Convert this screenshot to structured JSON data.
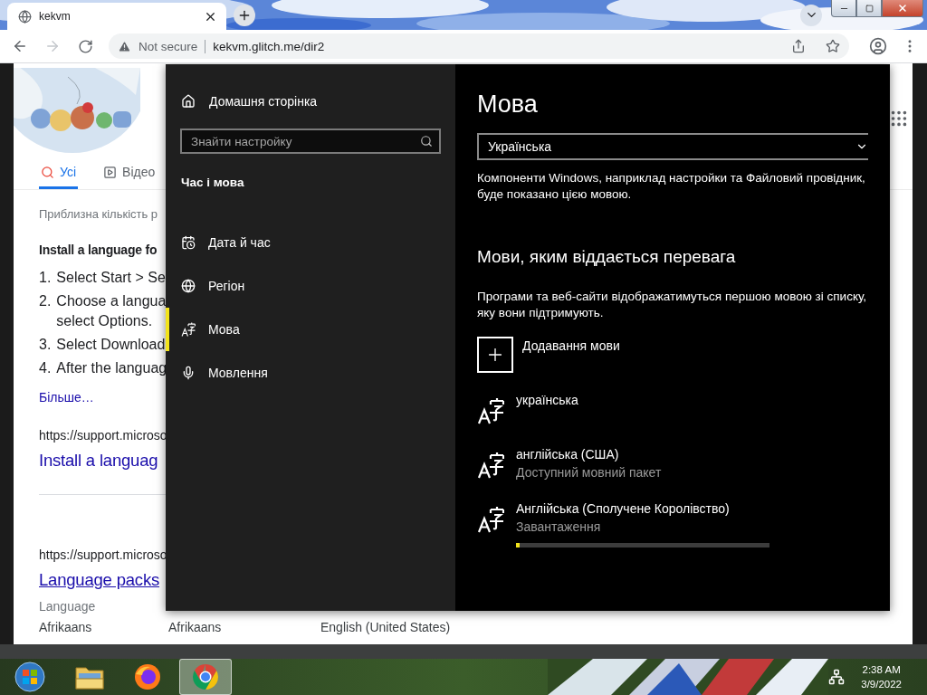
{
  "browser": {
    "tab": {
      "title": "kekvm"
    },
    "nav": [
      {
        "kind": "back",
        "disabled": false
      },
      {
        "kind": "forward",
        "disabled": true
      },
      {
        "kind": "reload",
        "disabled": false
      }
    ],
    "address": {
      "security": "Not secure",
      "url": "kekvm.glitch.me/dir2"
    }
  },
  "page": {
    "search_tabs": [
      {
        "kind": "all",
        "label": "Усі",
        "selected": true
      },
      {
        "kind": "video",
        "label": "Відео",
        "selected": false
      }
    ],
    "result_count": "Приблизна кількість р",
    "snippet": {
      "heading": "Install a language fo",
      "steps": [
        {
          "number": "1.",
          "lines": [
            "Select Start > Se"
          ]
        },
        {
          "number": "2.",
          "lines": [
            "Choose a langua",
            "select Options."
          ]
        },
        {
          "number": "3.",
          "lines": [
            "Select Download"
          ]
        },
        {
          "number": "4.",
          "lines": [
            "After the languag"
          ]
        }
      ],
      "more": "Більше…"
    },
    "results": [
      {
        "url": "https://support.microso",
        "title": "Install a languag",
        "hovered": false
      },
      {
        "url": "https://support.microso",
        "title": "Language packs",
        "hovered": true
      }
    ],
    "table": {
      "caption": "Language",
      "rows": [
        [
          "Afrikaans",
          "Afrikaans",
          "English (United States)"
        ]
      ]
    }
  },
  "settings": {
    "home": "Домашня сторінка",
    "search": {
      "placeholder": "Знайти настройку"
    },
    "section": "Час і мова",
    "nav": [
      {
        "kind": "datetime",
        "label": "Дата й час",
        "selected": false
      },
      {
        "kind": "region",
        "label": "Регіон",
        "selected": false
      },
      {
        "kind": "language",
        "label": "Мова",
        "selected": true
      },
      {
        "kind": "speech",
        "label": "Мовлення",
        "selected": false
      }
    ],
    "title": "Мова",
    "display_language": {
      "value": "Українська"
    },
    "display_note": "Компоненти Windows, наприклад настройки та Файловий провідник, буде показано цією мовою.",
    "preferred": {
      "heading": "Мови, яким віддається перевага",
      "note": "Програми та веб-сайти відображатимуться першою мовою зі списку, яку вони підтримують.",
      "add": "Додавання мови",
      "languages": [
        {
          "name": "українська"
        },
        {
          "name": "англійська (США)",
          "status": "Доступний мовний пакет"
        },
        {
          "name": "Англійська (Сполучене Королівство)",
          "status": "Завантаження",
          "level": 0.015
        }
      ]
    }
  },
  "taskbar": {
    "apps": [
      {
        "kind": "explorer",
        "selected": false
      },
      {
        "kind": "firefox",
        "selected": false
      },
      {
        "kind": "chrome",
        "selected": true
      }
    ],
    "clock": {
      "time": "2:38 AM",
      "date": "3/9/2022"
    }
  }
}
